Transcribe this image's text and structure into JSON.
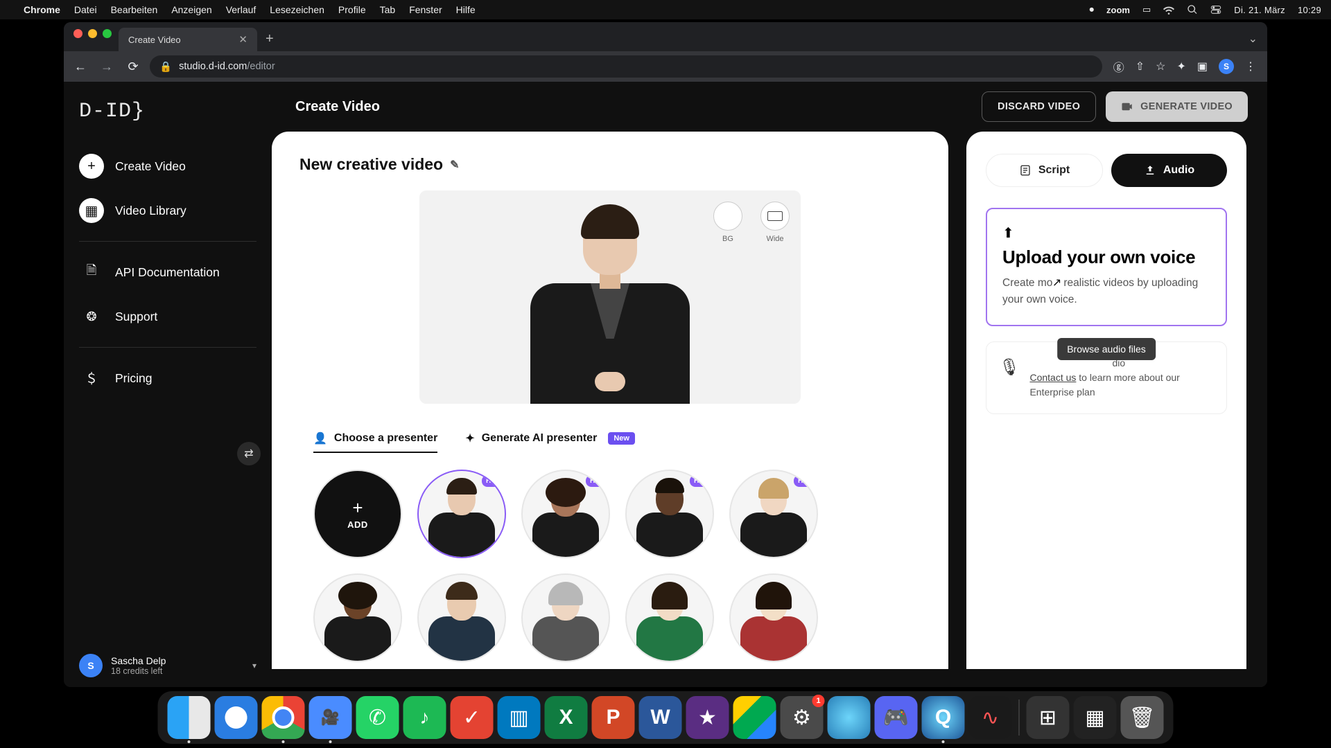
{
  "menubar": {
    "apple": "",
    "app": "Chrome",
    "items": [
      "Datei",
      "Bearbeiten",
      "Anzeigen",
      "Verlauf",
      "Lesezeichen",
      "Profile",
      "Tab",
      "Fenster",
      "Hilfe"
    ],
    "zoom_label": "zoom",
    "date": "Di. 21. März",
    "time": "10:29"
  },
  "browser": {
    "tab_title": "Create Video",
    "url_host": "studio.d-id.com",
    "url_path": "/editor",
    "profile_initial": "S"
  },
  "sidebar": {
    "logo": "D-ID}",
    "items": [
      {
        "label": "Create Video"
      },
      {
        "label": "Video Library"
      },
      {
        "label": "API Documentation"
      },
      {
        "label": "Support"
      },
      {
        "label": "Pricing"
      }
    ],
    "user": {
      "initial": "S",
      "name": "Sascha Delp",
      "credits": "18 credits left"
    }
  },
  "topbar": {
    "title": "Create Video",
    "discard": "DISCARD VIDEO",
    "generate": "GENERATE VIDEO"
  },
  "project": {
    "title": "New creative video",
    "bg_label": "BG",
    "wide_label": "Wide"
  },
  "presenter_tabs": {
    "choose": "Choose a presenter",
    "generate": "Generate AI presenter",
    "new_badge": "New"
  },
  "presenters": {
    "add": "ADD",
    "hq": "HQ",
    "row1": [
      {
        "selected": true,
        "hq": true,
        "skin": "#e8c9b0",
        "hair": "#2b1e14",
        "suit": "#1a1a1a"
      },
      {
        "hq": true,
        "skin": "#a9765a",
        "hair": "#2c1a10",
        "suit": "#1a1a1a"
      },
      {
        "hq": true,
        "skin": "#5f3d28",
        "hair": "#1a120a",
        "suit": "#1a1a1a"
      },
      {
        "hq": true,
        "skin": "#f0d7c2",
        "hair": "#caa46a",
        "suit": "#1a1a1a"
      }
    ],
    "row2": [
      {
        "skin": "#6b4328",
        "hair": "#1f150c",
        "suit": "#1a1a1a"
      },
      {
        "skin": "#e9cbb0",
        "hair": "#3d2b1a",
        "suit": "#223"
      },
      {
        "skin": "#eed6c2",
        "hair": "#b8b8b8",
        "suit": "#555"
      },
      {
        "skin": "#f2dcc6",
        "hair": "#2a1c10",
        "suit": "#274"
      },
      {
        "skin": "#f3dfc7",
        "hair": "#20140a",
        "suit": "#a33"
      }
    ]
  },
  "panel": {
    "script_label": "Script",
    "audio_label": "Audio",
    "upload_title": "Upload your own voice",
    "upload_desc_a": "Create mo",
    "upload_desc_b": "realistic videos by uploading your own voice.",
    "browse_tooltip": "Browse audio files",
    "clone_tail": "dio",
    "contact": "Contact us",
    "clone_rest": " to learn more about our Enterprise plan"
  },
  "dock": {
    "settings_badge": "1"
  }
}
